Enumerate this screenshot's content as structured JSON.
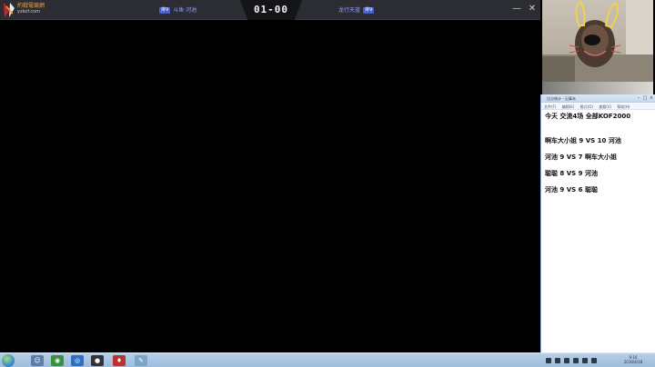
{
  "game_window": {
    "logo_text": "約戰電競網",
    "logo_subtext": "yzkof.com",
    "player_left": {
      "badge": "排9",
      "name": "斗鱼·河池"
    },
    "player_right": {
      "name": "龙行天蓝",
      "badge": "排9"
    },
    "score": "01-00",
    "controls": {
      "minimize": "—",
      "close": "✕"
    }
  },
  "notepad": {
    "title": "比分统计 - 记事本",
    "menu": [
      "文件(F)",
      "编辑(E)",
      "格式(O)",
      "查看(V)",
      "帮助(H)"
    ],
    "lines": [
      "今天 交流4场 全部KOF2000",
      "",
      "",
      "啊车大小姐 9 VS 10 河池",
      "",
      "河池 9 VS 7 啊车大小姐",
      "",
      "聪聪 8 VS 9 河池",
      "",
      "河池 9 VS 6 聪聪"
    ]
  },
  "taskbar": {
    "clock_time": "9:16",
    "clock_date": "2016/4/18"
  },
  "colors": {
    "title_bg": "#2b2d32",
    "accent_orange": "#f29a2e",
    "player_blue": "#8ea2ff",
    "badge_blue": "#4a5fc8",
    "taskbar": "#9dbbdc"
  }
}
